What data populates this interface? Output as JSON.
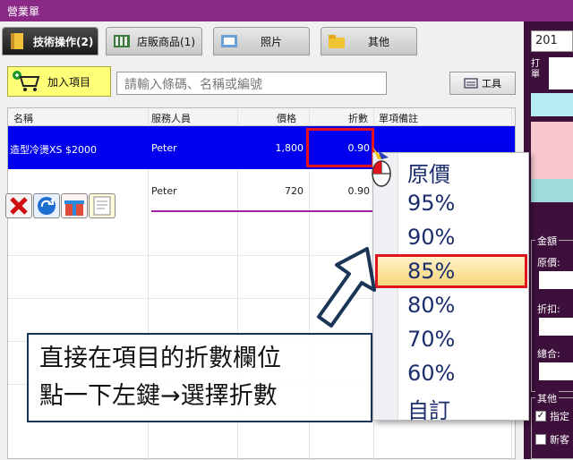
{
  "window": {
    "title": "營業單"
  },
  "tabs": [
    {
      "label": "技術操作(2)",
      "icon": "book-icon",
      "active": true
    },
    {
      "label": "店販商品(1)",
      "icon": "shelf-icon",
      "active": false
    },
    {
      "label": "照片",
      "icon": "photo-icon",
      "active": false
    },
    {
      "label": "其他",
      "icon": "folder-icon",
      "active": false
    }
  ],
  "toolbar": {
    "add_label": "加入項目",
    "search_placeholder": "請輸入條碼、名稱或編號",
    "tool_label": "工具"
  },
  "grid": {
    "columns": [
      "名稱",
      "服務人員",
      "價格",
      "折數",
      "單項備註"
    ],
    "rows": [
      {
        "name": "造型冷燙XS $2000",
        "staff": "Peter",
        "price": "1,800",
        "discount": "0.90",
        "note": "",
        "selected": true
      },
      {
        "name": "",
        "staff": "Peter",
        "price": "720",
        "discount": "0.90",
        "note": "",
        "selected": false
      }
    ]
  },
  "row_icons": [
    "delete-icon",
    "refresh-icon",
    "gift-icon",
    "document-icon"
  ],
  "discount_menu": {
    "items": [
      "原價",
      "95%",
      "90%",
      "85%",
      "80%",
      "70%",
      "60%",
      "自訂"
    ],
    "highlighted": "85%"
  },
  "callout": {
    "line1": "直接在項目的折數欄位",
    "line2": "點一下左鍵→選擇折數"
  },
  "right_panel": {
    "date": "201",
    "print_label": "打單",
    "amount_group": "金額",
    "original_label": "原價:",
    "discount_label": "折扣:",
    "total_label": "總合:",
    "other_group": "其他",
    "check1": "指定",
    "check2": "新客"
  },
  "colors": {
    "title_bar": "#8a2a86",
    "selection": "#0000ee",
    "highlight_border": "#e0141c",
    "menu_text": "#1c2d6e"
  }
}
